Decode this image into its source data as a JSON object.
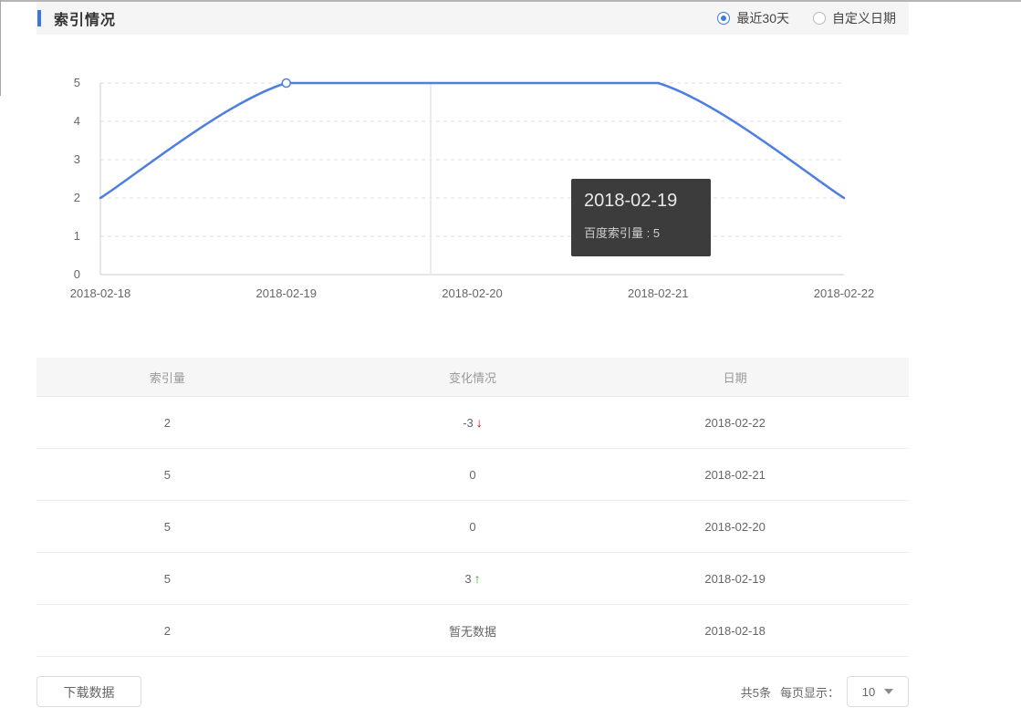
{
  "header": {
    "title": "索引情况",
    "range_options": [
      {
        "label": "最近30天",
        "selected": true
      },
      {
        "label": "自定义日期",
        "selected": false
      }
    ]
  },
  "chart_data": {
    "type": "line",
    "x": [
      "2018-02-18",
      "2018-02-19",
      "2018-02-20",
      "2018-02-21",
      "2018-02-22"
    ],
    "series": [
      {
        "name": "百度索引量",
        "values": [
          2,
          5,
          5,
          5,
          2
        ]
      }
    ],
    "title": "",
    "xlabel": "",
    "ylabel": "",
    "ylim": [
      0,
      5
    ],
    "yticks": [
      0,
      1,
      2,
      3,
      4,
      5
    ],
    "grid": "horizontal-dashed",
    "smooth": true,
    "legend": "none",
    "line_color": "#4e7fe0",
    "hover": {
      "index": 1,
      "tooltip_title": "2018-02-19",
      "tooltip_line": "百度索引量 : 5"
    }
  },
  "table": {
    "columns": [
      "索引量",
      "变化情况",
      "日期"
    ],
    "rows": [
      {
        "index": "2",
        "change": "-3",
        "change_dir": "down",
        "date": "2018-02-22"
      },
      {
        "index": "5",
        "change": "0",
        "change_dir": "none",
        "date": "2018-02-21"
      },
      {
        "index": "5",
        "change": "0",
        "change_dir": "none",
        "date": "2018-02-20"
      },
      {
        "index": "5",
        "change": "3",
        "change_dir": "up",
        "date": "2018-02-19"
      },
      {
        "index": "2",
        "change": "暂无数据",
        "change_dir": "none",
        "date": "2018-02-18"
      }
    ]
  },
  "footer": {
    "download_label": "下载数据",
    "total_text": "共5条",
    "per_page_label": "每页显示：",
    "page_size": "10"
  },
  "colors": {
    "accent_blue": "#3b76e8",
    "radio_blue": "#3a7ce0",
    "line_blue": "#4e7fe0",
    "up_green": "#3aa23a",
    "down_red": "#e60000"
  }
}
